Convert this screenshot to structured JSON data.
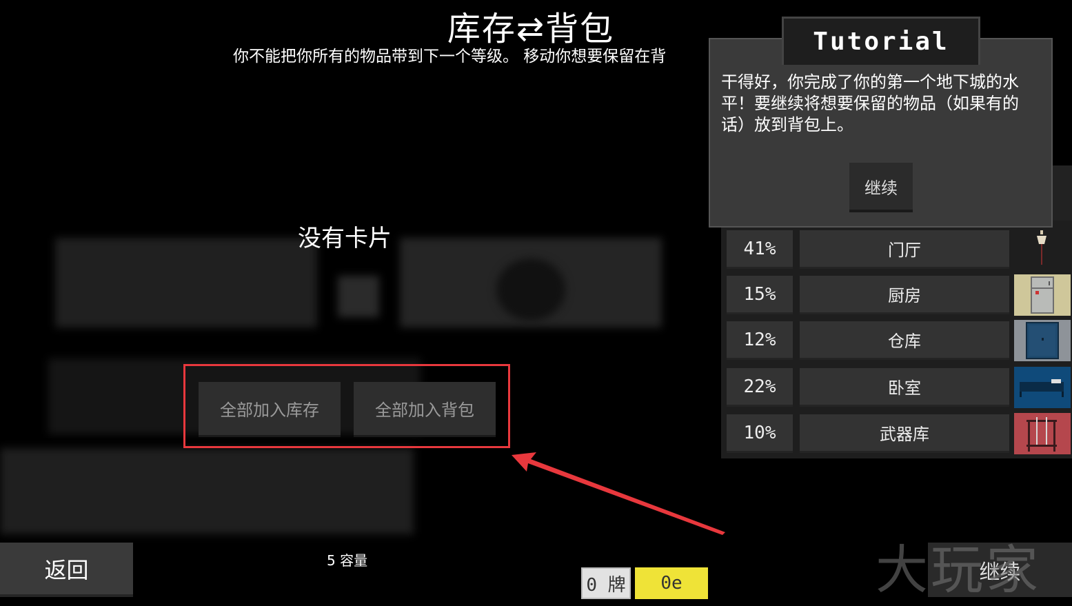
{
  "header": {
    "title": "库存⇄背包",
    "subtitle": "你不能把你所有的物品带到下一个等级。 移动你想要保留在背"
  },
  "main": {
    "empty_text": "没有卡片",
    "add_all_inventory": "全部加入库存",
    "add_all_backpack": "全部加入背包",
    "capacity": "5 容量"
  },
  "footer": {
    "back_label": "返回",
    "deck_count": "0 牌",
    "energy": "0e",
    "continue_label": "继续"
  },
  "rooms": [
    {
      "percent": "41%",
      "name": "门厅",
      "icon": "lamp-icon",
      "color": "#1e1e1e"
    },
    {
      "percent": "15%",
      "name": "厨房",
      "icon": "fridge-icon",
      "color": "#cfc79a"
    },
    {
      "percent": "12%",
      "name": "仓库",
      "icon": "cabinet-icon",
      "color": "#8e9399"
    },
    {
      "percent": "22%",
      "name": "卧室",
      "icon": "bed-icon",
      "color": "#0f4a7a"
    },
    {
      "percent": "10%",
      "name": "武器库",
      "icon": "weapon-rack-icon",
      "color": "#b5474d"
    }
  ],
  "tutorial": {
    "title": "Tutorial",
    "message": "干得好，你完成了你的第一个地下城的水平！要继续将想要保留的物品（如果有的话）放到背包上。",
    "continue_label": "继续"
  },
  "watermark": "大玩家",
  "colors": {
    "highlight": "#e8383d",
    "energy_bg": "#efe337"
  }
}
